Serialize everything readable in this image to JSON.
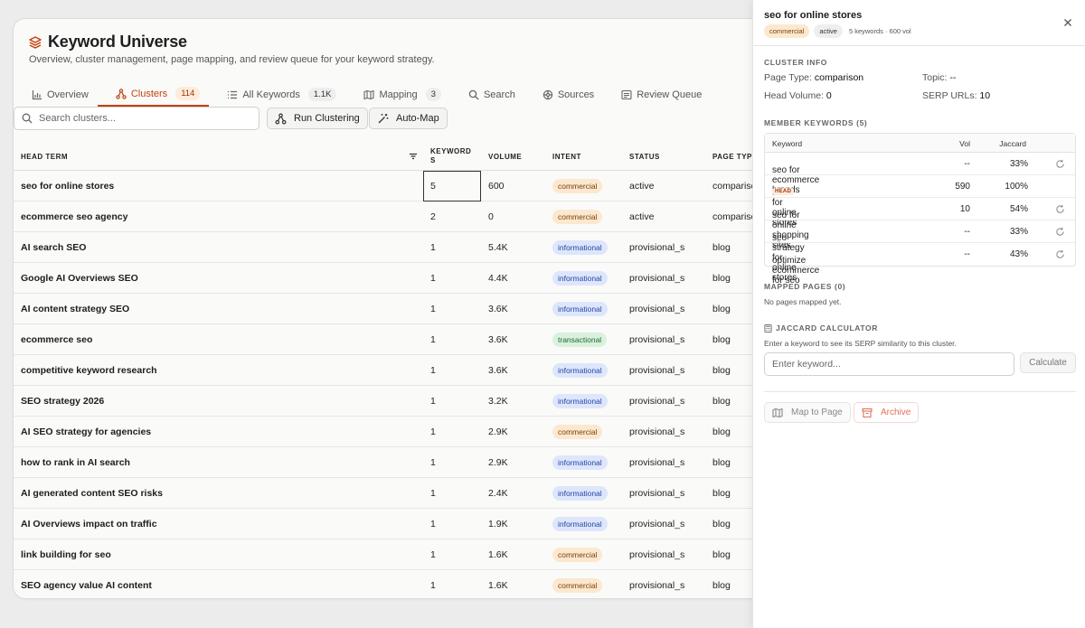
{
  "app": {
    "title": "Keyword Universe",
    "subtitle": "Overview, cluster management, page mapping, and review queue for your keyword strategy."
  },
  "tabs": [
    {
      "label": "Overview",
      "icon": "bar-chart-icon",
      "count": ""
    },
    {
      "label": "Clusters",
      "icon": "clusters-icon",
      "count": "114",
      "active": true
    },
    {
      "label": "All Keywords",
      "icon": "list-icon",
      "count": "1.1K"
    },
    {
      "label": "Mapping",
      "icon": "map-icon",
      "count": "3"
    },
    {
      "label": "Search",
      "icon": "search-icon",
      "count": ""
    },
    {
      "label": "Sources",
      "icon": "sources-icon",
      "count": ""
    },
    {
      "label": "Review Queue",
      "icon": "review-queue-icon",
      "count": ""
    }
  ],
  "toolbar": {
    "search_placeholder": "Search clusters...",
    "run_clustering_label": "Run Clustering",
    "auto_map_label": "Auto-Map"
  },
  "table": {
    "columns": {
      "head_term": "HEAD TERM",
      "keywords_line1": "KEYWORD",
      "keywords_line2": "S",
      "volume": "VOLUME",
      "intent": "INTENT",
      "status": "STATUS",
      "page_type": "PAGE TYPE"
    },
    "rows": [
      {
        "head": "seo for online stores",
        "keywords": "5",
        "volume": "600",
        "intent": "commercial",
        "status": "active",
        "page_type": "comparison"
      },
      {
        "head": "ecommerce seo agency",
        "keywords": "2",
        "volume": "0",
        "intent": "commercial",
        "status": "active",
        "page_type": "comparison"
      },
      {
        "head": "AI search SEO",
        "keywords": "1",
        "volume": "5.4K",
        "intent": "informational",
        "status": "provisional_singleton",
        "page_type": "blog"
      },
      {
        "head": "Google AI Overviews SEO",
        "keywords": "1",
        "volume": "4.4K",
        "intent": "informational",
        "status": "provisional_singleton",
        "page_type": "blog"
      },
      {
        "head": "AI content strategy SEO",
        "keywords": "1",
        "volume": "3.6K",
        "intent": "informational",
        "status": "provisional_singleton",
        "page_type": "blog"
      },
      {
        "head": "ecommerce seo",
        "keywords": "1",
        "volume": "3.6K",
        "intent": "transactional",
        "status": "provisional_singleton",
        "page_type": "blog"
      },
      {
        "head": "competitive keyword research",
        "keywords": "1",
        "volume": "3.6K",
        "intent": "informational",
        "status": "provisional_singleton",
        "page_type": "blog"
      },
      {
        "head": "SEO strategy 2026",
        "keywords": "1",
        "volume": "3.2K",
        "intent": "informational",
        "status": "provisional_singleton",
        "page_type": "blog"
      },
      {
        "head": "AI SEO strategy for agencies",
        "keywords": "1",
        "volume": "2.9K",
        "intent": "commercial",
        "status": "provisional_singleton",
        "page_type": "blog"
      },
      {
        "head": "how to rank in AI search",
        "keywords": "1",
        "volume": "2.9K",
        "intent": "informational",
        "status": "provisional_singleton",
        "page_type": "blog"
      },
      {
        "head": "AI generated content SEO risks",
        "keywords": "1",
        "volume": "2.4K",
        "intent": "informational",
        "status": "provisional_singleton",
        "page_type": "blog"
      },
      {
        "head": "AI Overviews impact on traffic",
        "keywords": "1",
        "volume": "1.9K",
        "intent": "informational",
        "status": "provisional_singleton",
        "page_type": "blog"
      },
      {
        "head": "link building for seo",
        "keywords": "1",
        "volume": "1.6K",
        "intent": "commercial",
        "status": "provisional_singleton",
        "page_type": "blog"
      },
      {
        "head": "SEO agency value AI content",
        "keywords": "1",
        "volume": "1.6K",
        "intent": "commercial",
        "status": "provisional_singleton",
        "page_type": "blog"
      }
    ]
  },
  "panel": {
    "title": "seo for online stores",
    "intent_badge": "commercial",
    "status_badge": "active",
    "meta": "5 keywords · 600 vol",
    "cluster_info_label": "CLUSTER INFO",
    "page_type_label": "Page Type:",
    "page_type_value": "comparison",
    "topic_label": "Topic:",
    "topic_value": "--",
    "head_volume_label": "Head Volume:",
    "head_volume_value": "0",
    "serp_urls_label": "SERP URLs:",
    "serp_urls_value": "10",
    "member_keywords_label": "MEMBER KEYWORDS (5)",
    "member_columns": {
      "keyword": "Keyword",
      "vol": "Vol",
      "jaccard": "Jaccard"
    },
    "members": [
      {
        "keyword": "seo for ecommerce brands",
        "vol": "--",
        "jaccard": "33%",
        "head": false
      },
      {
        "keyword": "seo for online stores",
        "vol": "590",
        "jaccard": "100%",
        "head": true
      },
      {
        "keyword": "seo for online shopping sites",
        "vol": "10",
        "jaccard": "54%",
        "head": false
      },
      {
        "keyword": "seo strategy for online stores",
        "vol": "--",
        "jaccard": "33%",
        "head": false
      },
      {
        "keyword": "optimize ecommerce for seo",
        "vol": "--",
        "jaccard": "43%",
        "head": false
      }
    ],
    "head_tag": "HEAD",
    "mapped_pages_label": "MAPPED PAGES (0)",
    "mapped_pages_empty": "No pages mapped yet.",
    "jaccard_calc_label": "JACCARD CALCULATOR",
    "jaccard_calc_help": "Enter a keyword to see its SERP similarity to this cluster.",
    "jaccard_input_placeholder": "Enter keyword...",
    "calculate_label": "Calculate",
    "map_to_page_label": "Map to Page",
    "archive_label": "Archive"
  },
  "colors": {
    "accent": "#c2410c",
    "commercial_bg": "#fbe8cf",
    "informational_bg": "#dde6fb",
    "transactional_bg": "#d9f1dd"
  }
}
